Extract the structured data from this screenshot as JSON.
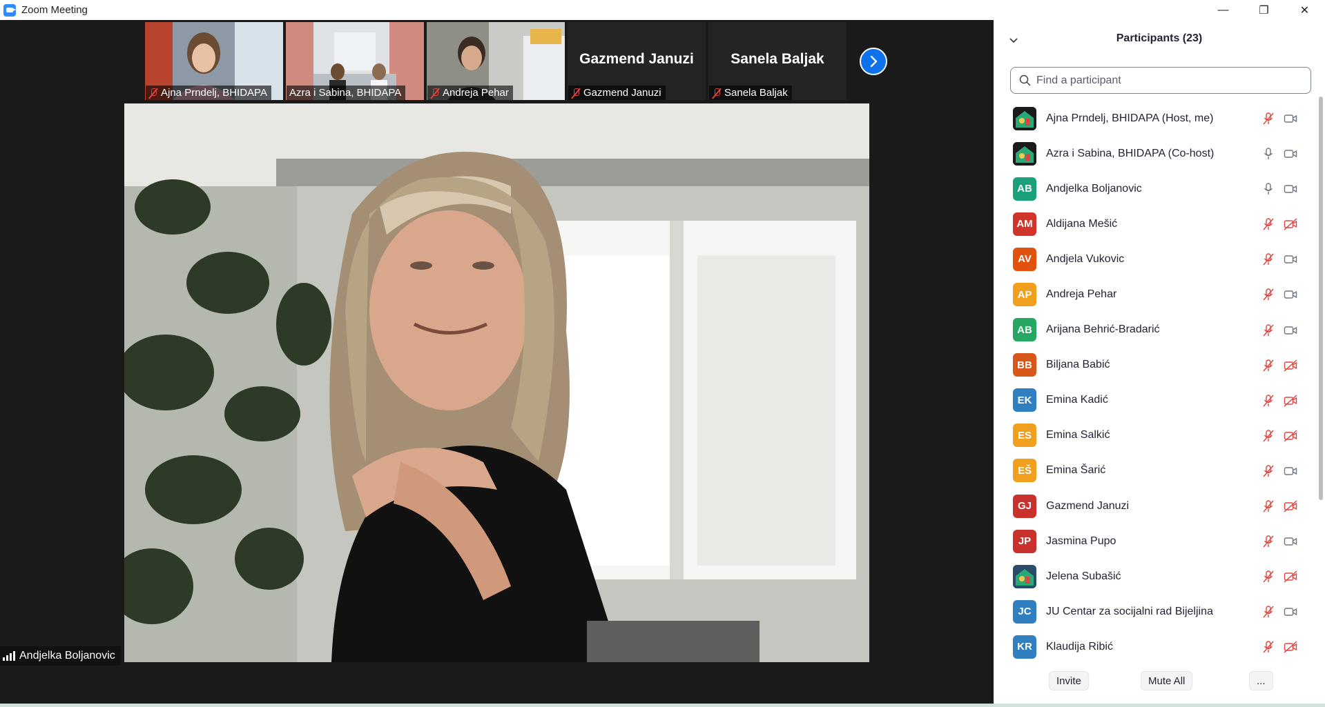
{
  "window": {
    "title": "Zoom Meeting",
    "controls": {
      "minimize": "—",
      "restore": "❐",
      "close": "✕"
    }
  },
  "gallery": {
    "tiles": [
      {
        "name": "Ajna Prndelj, BHIDAPA",
        "video": true,
        "muted": true
      },
      {
        "name": "Azra i Sabina, BHIDAPA",
        "video": true,
        "muted": false
      },
      {
        "name": "Andreja Pehar",
        "video": true,
        "muted": true
      },
      {
        "name": "Gazmend Januzi",
        "video": false,
        "muted": true
      },
      {
        "name": "Sanela Baljak",
        "video": false,
        "muted": true
      }
    ],
    "next_icon": "chevron-right-icon"
  },
  "active_speaker": {
    "name": "Andjelka Boljanovic"
  },
  "participants_panel": {
    "title": "Participants (23)",
    "search_placeholder": "Find a participant",
    "participants": [
      {
        "name": "Ajna Prndelj, BHIDAPA (Host, me)",
        "initials": "",
        "avatar_type": "image",
        "color": "#1b1b1b",
        "mic": "muted",
        "video": "on"
      },
      {
        "name": "Azra i Sabina, BHIDAPA (Co-host)",
        "initials": "",
        "avatar_type": "image",
        "color": "#1b1b1b",
        "mic": "on",
        "video": "on"
      },
      {
        "name": "Andjelka Boljanovic",
        "initials": "AB",
        "avatar_type": "initials",
        "color": "#1aa17c",
        "mic": "on",
        "video": "on"
      },
      {
        "name": "Aldijana Mešić",
        "initials": "AM",
        "avatar_type": "initials",
        "color": "#d0352b",
        "mic": "muted",
        "video": "off"
      },
      {
        "name": "Andjela Vukovic",
        "initials": "AV",
        "avatar_type": "initials",
        "color": "#e2520f",
        "mic": "muted",
        "video": "on"
      },
      {
        "name": "Andreja Pehar",
        "initials": "AP",
        "avatar_type": "initials",
        "color": "#f0a01e",
        "mic": "muted",
        "video": "on"
      },
      {
        "name": "Arijana Behrić-Bradarić",
        "initials": "AB",
        "avatar_type": "initials",
        "color": "#27a862",
        "mic": "muted",
        "video": "on"
      },
      {
        "name": "Biljana Babić",
        "initials": "BB",
        "avatar_type": "initials",
        "color": "#d8571a",
        "mic": "muted",
        "video": "off"
      },
      {
        "name": "Emina Kadić",
        "initials": "EK",
        "avatar_type": "initials",
        "color": "#2f7fc1",
        "mic": "muted",
        "video": "off"
      },
      {
        "name": "Emina Salkić",
        "initials": "ES",
        "avatar_type": "initials",
        "color": "#f0a01e",
        "mic": "muted",
        "video": "off"
      },
      {
        "name": "Emina Šarić",
        "initials": "EŠ",
        "avatar_type": "initials",
        "color": "#f0a01e",
        "mic": "muted",
        "video": "on"
      },
      {
        "name": "Gazmend Januzi",
        "initials": "GJ",
        "avatar_type": "initials",
        "color": "#c9312c",
        "mic": "muted",
        "video": "off"
      },
      {
        "name": "Jasmina Pupo",
        "initials": "JP",
        "avatar_type": "initials",
        "color": "#c9312c",
        "mic": "muted",
        "video": "on"
      },
      {
        "name": "Jelena Subašić",
        "initials": "",
        "avatar_type": "image",
        "color": "#2b4b6a",
        "mic": "muted",
        "video": "off"
      },
      {
        "name": "JU Centar za socijalni rad Bijeljina",
        "initials": "JC",
        "avatar_type": "initials",
        "color": "#2f7fc1",
        "mic": "muted",
        "video": "on"
      },
      {
        "name": "Klaudija Ribić",
        "initials": "KR",
        "avatar_type": "initials",
        "color": "#2f7fc1",
        "mic": "muted",
        "video": "off"
      }
    ],
    "footer": {
      "invite_label": "Invite",
      "mute_all_label": "Mute All",
      "more_label": "..."
    }
  },
  "colors": {
    "accent": "#0e72ed",
    "muted_red": "#e0443f",
    "icon_gray": "#6e7680"
  }
}
